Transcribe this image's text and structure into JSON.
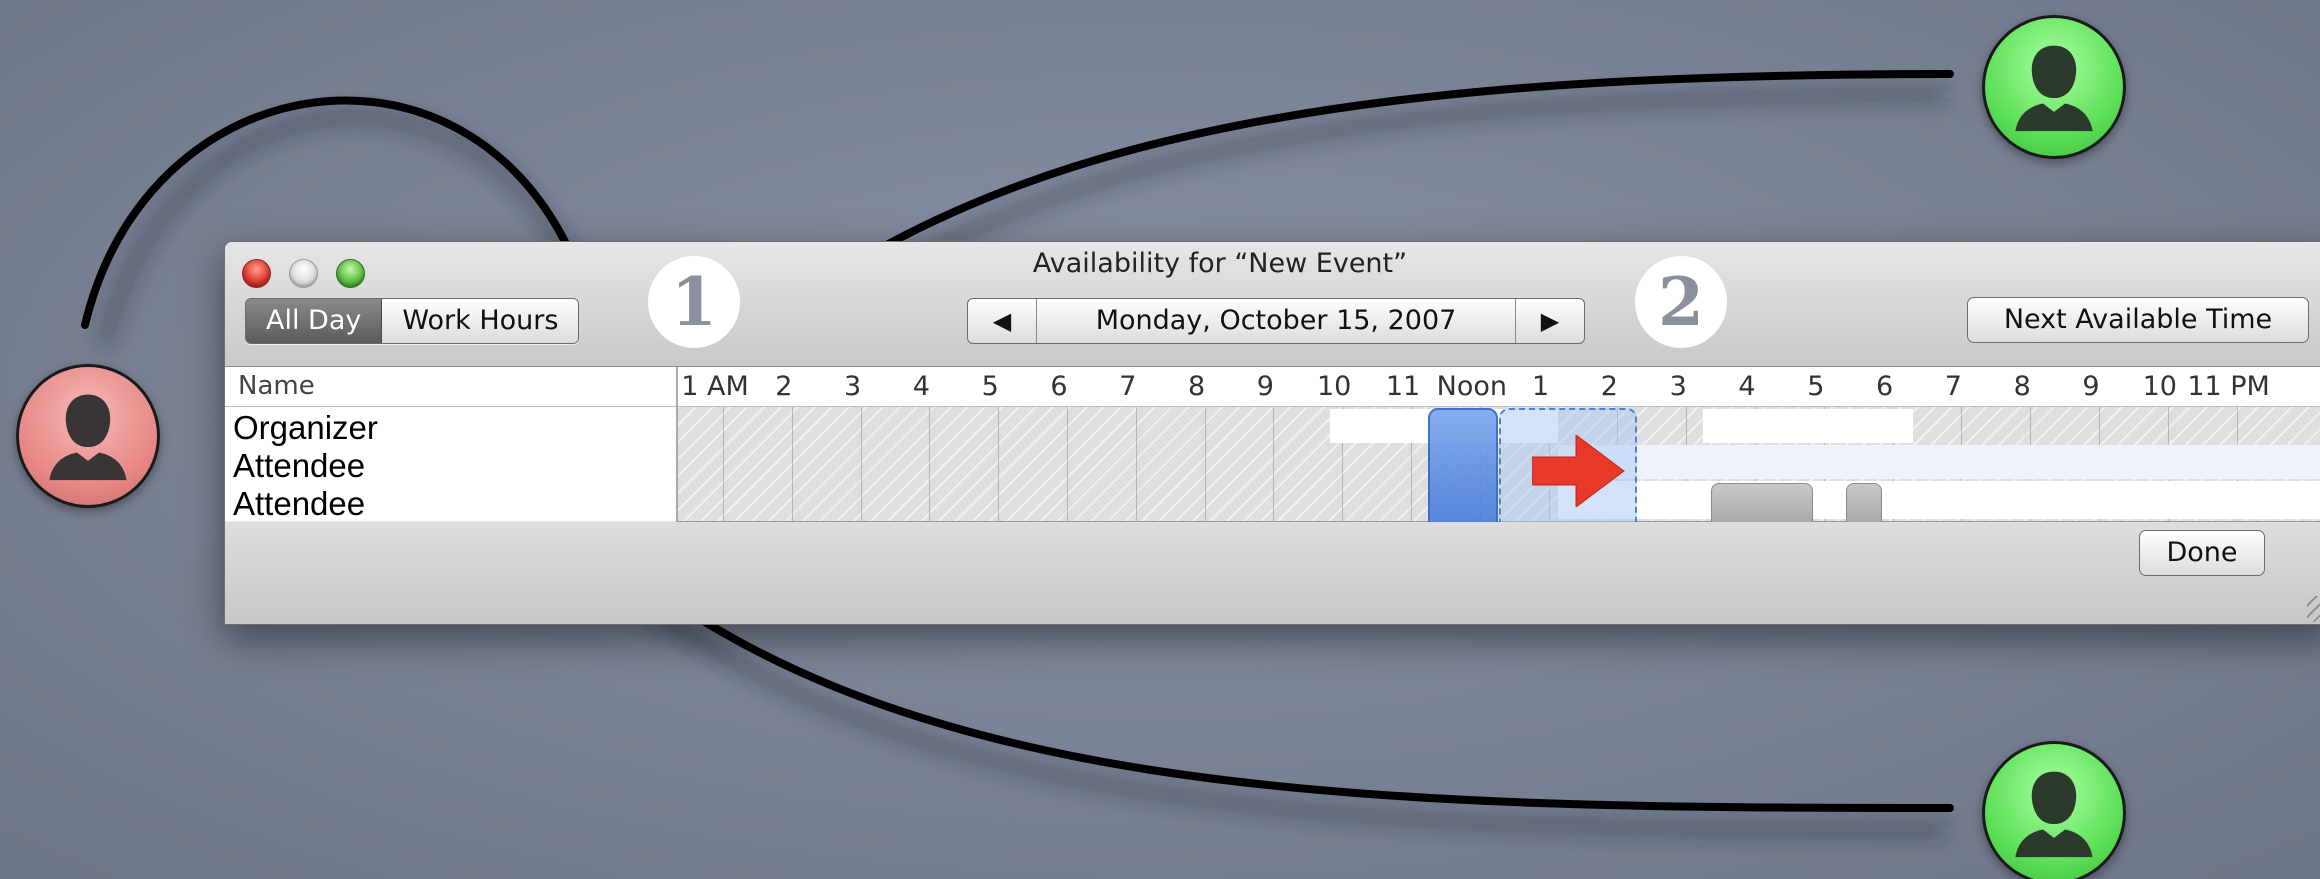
{
  "window": {
    "title": "Availability for “New Event”"
  },
  "toolbar": {
    "view_modes": [
      {
        "label": "All Day",
        "selected": true
      },
      {
        "label": "Work Hours",
        "selected": false
      }
    ],
    "prev_icon": "◀",
    "next_icon": "▶",
    "date_label": "Monday, October 15, 2007",
    "next_available_label": "Next Available Time"
  },
  "schedule": {
    "name_header": "Name",
    "hours": [
      "1 AM",
      "2",
      "3",
      "4",
      "5",
      "6",
      "7",
      "8",
      "9",
      "10",
      "11",
      "Noon",
      "1",
      "2",
      "3",
      "4",
      "5",
      "6",
      "7",
      "8",
      "9",
      "10",
      "11 PM"
    ],
    "attendees": [
      "Organizer",
      "Attendee",
      "Attendee"
    ]
  },
  "footer": {
    "done_label": "Done"
  },
  "annotations": {
    "step_badges": [
      "1",
      "2"
    ]
  },
  "colors": {
    "event_blue": "#3a72d6",
    "busy_gray": "#a5a5a5",
    "move_arrow_red": "#e8392b",
    "organizer_avatar": "#e88a88",
    "attendee_avatar": "#5fe05a"
  }
}
